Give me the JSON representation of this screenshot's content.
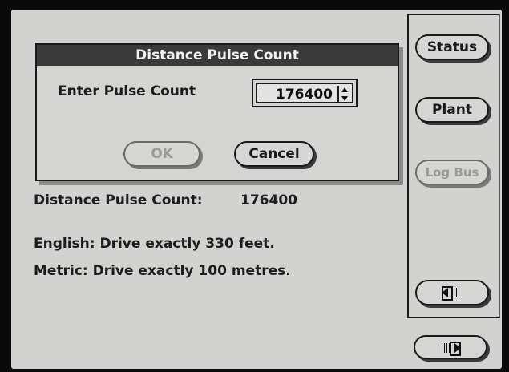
{
  "dialog": {
    "title": "Distance Pulse Count",
    "prompt": "Enter Pulse Count",
    "pulse_count_value": "176400",
    "ok_label": "OK",
    "cancel_label": "Cancel"
  },
  "info": {
    "distance_label": "Distance Pulse Count:",
    "distance_value": "176400",
    "english_line": "English: Drive exactly 330 feet.",
    "metric_line": "Metric: Drive exactly 100 metres."
  },
  "sidebar": {
    "status_label": "Status",
    "plant_label": "Plant",
    "log_bus_label": "Log Bus",
    "back_icon": "back-arrow-icon",
    "forward_icon": "forward-arrow-icon"
  }
}
